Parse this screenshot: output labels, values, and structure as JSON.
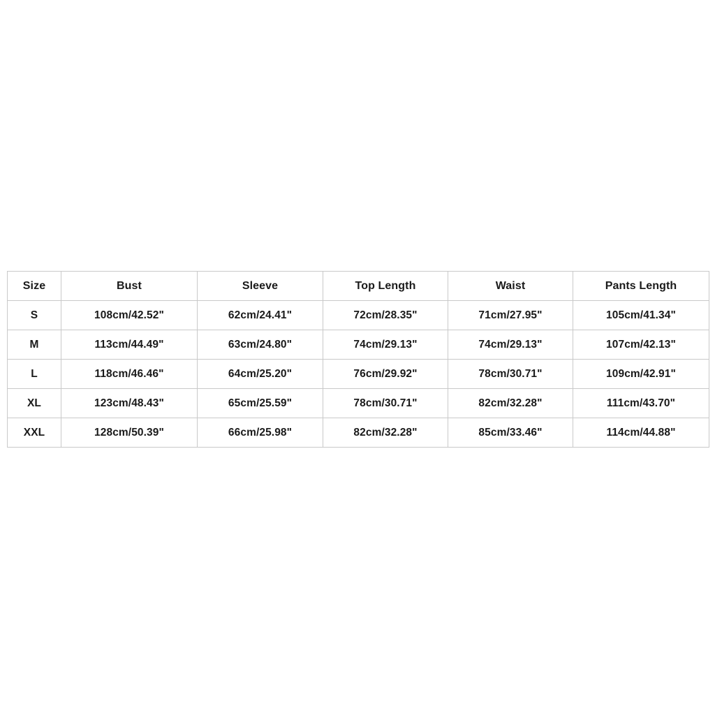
{
  "chart_data": {
    "type": "table",
    "title": "",
    "columns": [
      "Size",
      "Bust",
      "Sleeve",
      "Top Length",
      "Waist",
      "Pants Length"
    ],
    "rows": [
      {
        "size": "S",
        "bust": "108cm/42.52\"",
        "sleeve": "62cm/24.41\"",
        "top_length": "72cm/28.35\"",
        "waist": "71cm/27.95\"",
        "pants_length": "105cm/41.34\""
      },
      {
        "size": "M",
        "bust": "113cm/44.49\"",
        "sleeve": "63cm/24.80\"",
        "top_length": "74cm/29.13\"",
        "waist": "74cm/29.13\"",
        "pants_length": "107cm/42.13\""
      },
      {
        "size": "L",
        "bust": "118cm/46.46\"",
        "sleeve": "64cm/25.20\"",
        "top_length": "76cm/29.92\"",
        "waist": "78cm/30.71\"",
        "pants_length": "109cm/42.91\""
      },
      {
        "size": "XL",
        "bust": "123cm/48.43\"",
        "sleeve": "65cm/25.59\"",
        "top_length": "78cm/30.71\"",
        "waist": "82cm/32.28\"",
        "pants_length": "111cm/43.70\""
      },
      {
        "size": "XXL",
        "bust": "128cm/50.39\"",
        "sleeve": "66cm/25.98\"",
        "top_length": "82cm/32.28\"",
        "waist": "85cm/33.46\"",
        "pants_length": "114cm/44.88\""
      }
    ],
    "units": "cm / inches",
    "border_color": "#c9c9c9",
    "text_color": "#1a1a1a",
    "background_color": "#ffffff"
  }
}
